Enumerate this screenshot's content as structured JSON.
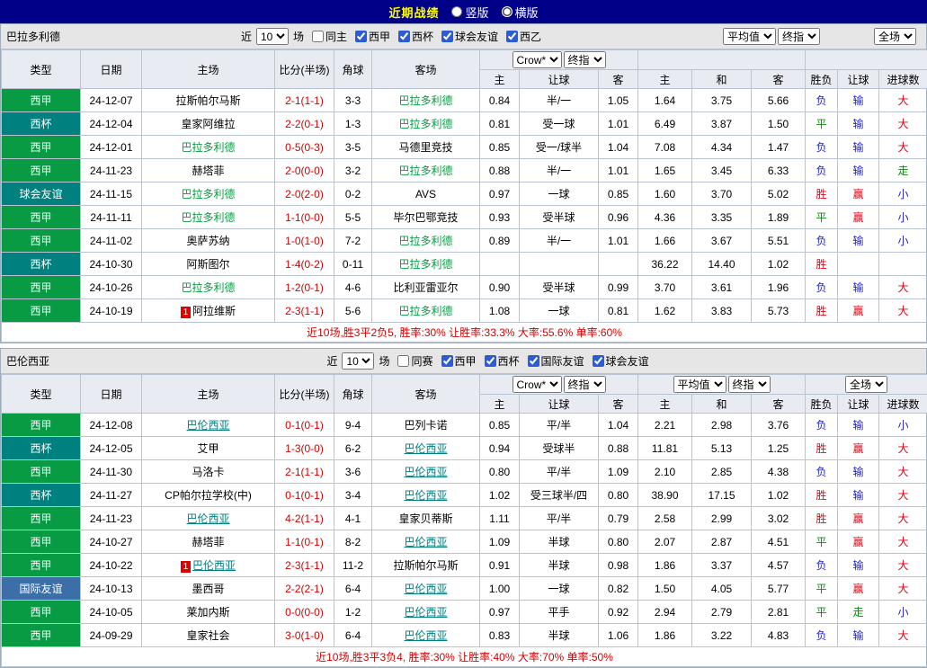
{
  "title_bar": {
    "title": "近期战绩",
    "options": [
      {
        "label": "竖版",
        "selected": false
      },
      {
        "label": "横版",
        "selected": true
      }
    ]
  },
  "colors": {
    "titlebar_bg": "#000089",
    "title_text": "#ffff00",
    "bar_bg": "#e6e6e6",
    "header_bg": "#e9ebf3",
    "grid_border": "#b9c3d3",
    "score_text": "#d40000",
    "footer_text": "#d40000"
  },
  "type_colors": {
    "西甲": "#089b43",
    "西杯": "#00807e",
    "球会友谊": "#00807e",
    "国际友谊": "#3c6fa8"
  },
  "result_colors": {
    "胜": "#e60012",
    "赢": "#e60012",
    "大": "#e60012",
    "平": "#0a8a0a",
    "走": "#0a8a0a",
    "负": "#2020d0",
    "输": "#2020d0",
    "小": "#2020d0"
  },
  "table_headers": {
    "type": "类型",
    "date": "日期",
    "home": "主场",
    "score": "比分(半场)",
    "corners": "角球",
    "away": "客场",
    "odds_sub": [
      "主",
      "让球",
      "客"
    ],
    "avg_sub": [
      "主",
      "和",
      "客"
    ],
    "result_sub": [
      "胜负",
      "让球",
      "进球数"
    ]
  },
  "sections": [
    {
      "team": "巴拉多利德",
      "team_color": "#089b43",
      "team_underline": false,
      "selects_in_bar": true,
      "filter": {
        "near_label": "近",
        "count": "10",
        "games_label": "场",
        "checkboxes": [
          {
            "label": "同主",
            "checked": false
          },
          {
            "label": "西甲",
            "checked": true
          },
          {
            "label": "西杯",
            "checked": true
          },
          {
            "label": "球会友谊",
            "checked": true
          },
          {
            "label": "西乙",
            "checked": true
          }
        ]
      },
      "selects": {
        "odds_source": "Crow*",
        "odds_time": "终指",
        "avg_source": "平均值",
        "avg_time": "终指",
        "scope": "全场"
      },
      "rows": [
        {
          "type": "西甲",
          "date": "24-12-07",
          "home": "拉斯帕尔马斯",
          "score": "2-1(1-1)",
          "corners": "3-3",
          "away": "巴拉多利德",
          "focus": "away",
          "odds": [
            "0.84",
            "半/一",
            "1.05"
          ],
          "avg": [
            "1.64",
            "3.75",
            "5.66"
          ],
          "res": [
            "负",
            "输",
            "大"
          ]
        },
        {
          "type": "西杯",
          "date": "24-12-04",
          "home": "皇家阿维拉",
          "score": "2-2(0-1)",
          "corners": "1-3",
          "away": "巴拉多利德",
          "focus": "away",
          "odds": [
            "0.81",
            "受一球",
            "1.01"
          ],
          "avg": [
            "6.49",
            "3.87",
            "1.50"
          ],
          "res": [
            "平",
            "输",
            "大"
          ]
        },
        {
          "type": "西甲",
          "date": "24-12-01",
          "home": "巴拉多利德",
          "score": "0-5(0-3)",
          "corners": "3-5",
          "away": "马德里竞技",
          "focus": "home",
          "odds": [
            "0.85",
            "受一/球半",
            "1.04"
          ],
          "avg": [
            "7.08",
            "4.34",
            "1.47"
          ],
          "res": [
            "负",
            "输",
            "大"
          ]
        },
        {
          "type": "西甲",
          "date": "24-11-23",
          "home": "赫塔菲",
          "score": "2-0(0-0)",
          "corners": "3-2",
          "away": "巴拉多利德",
          "focus": "away",
          "odds": [
            "0.88",
            "半/一",
            "1.01"
          ],
          "avg": [
            "1.65",
            "3.45",
            "6.33"
          ],
          "res": [
            "负",
            "输",
            "走"
          ]
        },
        {
          "type": "球会友谊",
          "date": "24-11-15",
          "home": "巴拉多利德",
          "score": "2-0(2-0)",
          "corners": "0-2",
          "away": "AVS",
          "focus": "home",
          "odds": [
            "0.97",
            "一球",
            "0.85"
          ],
          "avg": [
            "1.60",
            "3.70",
            "5.02"
          ],
          "res": [
            "胜",
            "赢",
            "小"
          ]
        },
        {
          "type": "西甲",
          "date": "24-11-11",
          "home": "巴拉多利德",
          "score": "1-1(0-0)",
          "corners": "5-5",
          "away": "毕尔巴鄂竞技",
          "focus": "home",
          "odds": [
            "0.93",
            "受半球",
            "0.96"
          ],
          "avg": [
            "4.36",
            "3.35",
            "1.89"
          ],
          "res": [
            "平",
            "赢",
            "小"
          ]
        },
        {
          "type": "西甲",
          "date": "24-11-02",
          "home": "奥萨苏纳",
          "score": "1-0(1-0)",
          "corners": "7-2",
          "away": "巴拉多利德",
          "focus": "away",
          "odds": [
            "0.89",
            "半/一",
            "1.01"
          ],
          "avg": [
            "1.66",
            "3.67",
            "5.51"
          ],
          "res": [
            "负",
            "输",
            "小"
          ]
        },
        {
          "type": "西杯",
          "date": "24-10-30",
          "home": "阿斯图尔",
          "score": "1-4(0-2)",
          "corners": "0-11",
          "away": "巴拉多利德",
          "focus": "away",
          "odds": [
            "",
            "",
            ""
          ],
          "avg": [
            "36.22",
            "14.40",
            "1.02"
          ],
          "res": [
            "胜",
            "",
            ""
          ]
        },
        {
          "type": "西甲",
          "date": "24-10-26",
          "home": "巴拉多利德",
          "score": "1-2(0-1)",
          "corners": "4-6",
          "away": "比利亚雷亚尔",
          "focus": "home",
          "odds": [
            "0.90",
            "受半球",
            "0.99"
          ],
          "avg": [
            "3.70",
            "3.61",
            "1.96"
          ],
          "res": [
            "负",
            "输",
            "大"
          ]
        },
        {
          "type": "西甲",
          "date": "24-10-19",
          "home": "阿拉维斯",
          "badge": "1",
          "badge_side": "home",
          "score": "2-3(1-1)",
          "corners": "5-6",
          "away": "巴拉多利德",
          "focus": "away",
          "odds": [
            "1.08",
            "一球",
            "0.81"
          ],
          "avg": [
            "1.62",
            "3.83",
            "5.73"
          ],
          "res": [
            "胜",
            "赢",
            "大"
          ]
        }
      ],
      "footer": "近10场,胜3平2负5, 胜率:30% 让胜率:33.3% 大率:55.6% 单率:60%"
    },
    {
      "team": "巴伦西亚",
      "team_color": "#008080",
      "team_underline": true,
      "selects_in_bar": false,
      "filter": {
        "near_label": "近",
        "count": "10",
        "games_label": "场",
        "checkboxes": [
          {
            "label": "同赛",
            "checked": false
          },
          {
            "label": "西甲",
            "checked": true
          },
          {
            "label": "西杯",
            "checked": true
          },
          {
            "label": "国际友谊",
            "checked": true
          },
          {
            "label": "球会友谊",
            "checked": true
          }
        ]
      },
      "selects": {
        "odds_source": "Crow*",
        "odds_time": "终指",
        "avg_source": "平均值",
        "avg_time": "终指",
        "scope": "全场"
      },
      "rows": [
        {
          "type": "西甲",
          "date": "24-12-08",
          "home": "巴伦西亚",
          "focus": "home",
          "score": "0-1(0-1)",
          "corners": "9-4",
          "away": "巴列卡诺",
          "odds": [
            "0.85",
            "平/半",
            "1.04"
          ],
          "avg": [
            "2.21",
            "2.98",
            "3.76"
          ],
          "res": [
            "负",
            "输",
            "小"
          ]
        },
        {
          "type": "西杯",
          "date": "24-12-05",
          "home": "艾甲",
          "score": "1-3(0-0)",
          "corners": "6-2",
          "away": "巴伦西亚",
          "focus": "away",
          "odds": [
            "0.94",
            "受球半",
            "0.88"
          ],
          "avg": [
            "11.81",
            "5.13",
            "1.25"
          ],
          "res": [
            "胜",
            "赢",
            "大"
          ]
        },
        {
          "type": "西甲",
          "date": "24-11-30",
          "home": "马洛卡",
          "score": "2-1(1-1)",
          "corners": "3-6",
          "away": "巴伦西亚",
          "focus": "away",
          "odds": [
            "0.80",
            "平/半",
            "1.09"
          ],
          "avg": [
            "2.10",
            "2.85",
            "4.38"
          ],
          "res": [
            "负",
            "输",
            "大"
          ]
        },
        {
          "type": "西杯",
          "date": "24-11-27",
          "home": "CP帕尔拉学校(中)",
          "score": "0-1(0-1)",
          "corners": "3-4",
          "away": "巴伦西亚",
          "focus": "away",
          "odds": [
            "1.02",
            "受三球半/四",
            "0.80"
          ],
          "avg": [
            "38.90",
            "17.15",
            "1.02"
          ],
          "res": [
            "胜",
            "输",
            "大"
          ]
        },
        {
          "type": "西甲",
          "date": "24-11-23",
          "home": "巴伦西亚",
          "focus": "home",
          "score": "4-2(1-1)",
          "corners": "4-1",
          "away": "皇家贝蒂斯",
          "odds": [
            "1.11",
            "平/半",
            "0.79"
          ],
          "avg": [
            "2.58",
            "2.99",
            "3.02"
          ],
          "res": [
            "胜",
            "赢",
            "大"
          ]
        },
        {
          "type": "西甲",
          "date": "24-10-27",
          "home": "赫塔菲",
          "score": "1-1(0-1)",
          "corners": "8-2",
          "away": "巴伦西亚",
          "focus": "away",
          "odds": [
            "1.09",
            "半球",
            "0.80"
          ],
          "avg": [
            "2.07",
            "2.87",
            "4.51"
          ],
          "res": [
            "平",
            "赢",
            "大"
          ]
        },
        {
          "type": "西甲",
          "date": "24-10-22",
          "home": "巴伦西亚",
          "focus": "home",
          "badge": "1",
          "badge_side": "home",
          "score": "2-3(1-1)",
          "corners": "11-2",
          "away": "拉斯帕尔马斯",
          "odds": [
            "0.91",
            "半球",
            "0.98"
          ],
          "avg": [
            "1.86",
            "3.37",
            "4.57"
          ],
          "res": [
            "负",
            "输",
            "大"
          ]
        },
        {
          "type": "国际友谊",
          "date": "24-10-13",
          "home": "墨西哥",
          "score": "2-2(2-1)",
          "corners": "6-4",
          "away": "巴伦西亚",
          "focus": "away",
          "odds": [
            "1.00",
            "一球",
            "0.82"
          ],
          "avg": [
            "1.50",
            "4.05",
            "5.77"
          ],
          "res": [
            "平",
            "赢",
            "大"
          ]
        },
        {
          "type": "西甲",
          "date": "24-10-05",
          "home": "莱加内斯",
          "score": "0-0(0-0)",
          "corners": "1-2",
          "away": "巴伦西亚",
          "focus": "away",
          "odds": [
            "0.97",
            "平手",
            "0.92"
          ],
          "avg": [
            "2.94",
            "2.79",
            "2.81"
          ],
          "res": [
            "平",
            "走",
            "小"
          ]
        },
        {
          "type": "西甲",
          "date": "24-09-29",
          "home": "皇家社会",
          "score": "3-0(1-0)",
          "corners": "6-4",
          "away": "巴伦西亚",
          "focus": "away",
          "odds": [
            "0.83",
            "半球",
            "1.06"
          ],
          "avg": [
            "1.86",
            "3.22",
            "4.83"
          ],
          "res": [
            "负",
            "输",
            "大"
          ]
        }
      ],
      "footer": "近10场,胜3平3负4, 胜率:30% 让胜率:40% 大率:70% 单率:50%"
    }
  ]
}
